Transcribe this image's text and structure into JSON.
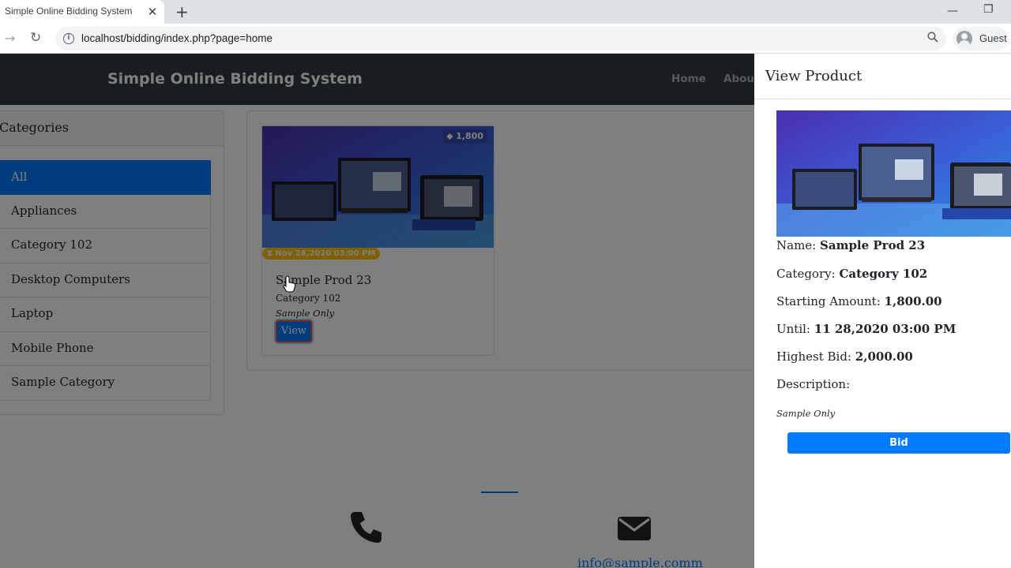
{
  "browser": {
    "tab_title": "Simple Online Bidding System",
    "tab_close": "✕",
    "new_tab": "+",
    "url": "localhost/bidding/index.php?page=home",
    "profile": "Guest"
  },
  "navbar": {
    "brand": "Simple Online Bidding System",
    "links": [
      "Home",
      "About"
    ]
  },
  "categories": {
    "title": "Categories",
    "items": [
      "All",
      "Appliances",
      "Category 102",
      "Desktop Computers",
      "Laptop",
      "Mobile Phone",
      "Sample Category"
    ],
    "active": "All"
  },
  "product_card": {
    "price": "1,800",
    "until": "Nov 28,2020 03:00 PM",
    "name": "Sample Prod 23",
    "category": "Category 102",
    "description": "Sample Only",
    "view_label": "View"
  },
  "contact": {
    "email": "info@sample.comm"
  },
  "view_panel": {
    "title": "View Product",
    "name_label": "Name:",
    "name": "Sample Prod 23",
    "category_label": "Category:",
    "category": "Category 102",
    "starting_label": "Starting Amount:",
    "starting_amount": "1,800.00",
    "until_label": "Until:",
    "until": "11 28,2020 03:00 PM",
    "highest_label": "Highest Bid:",
    "highest_bid": "2,000.00",
    "description_label": "Description:",
    "description": "Sample Only",
    "bid_label": "Bid"
  },
  "colors": {
    "primary": "#007bff",
    "navbar": "#343a40",
    "warning": "#ffc107"
  }
}
